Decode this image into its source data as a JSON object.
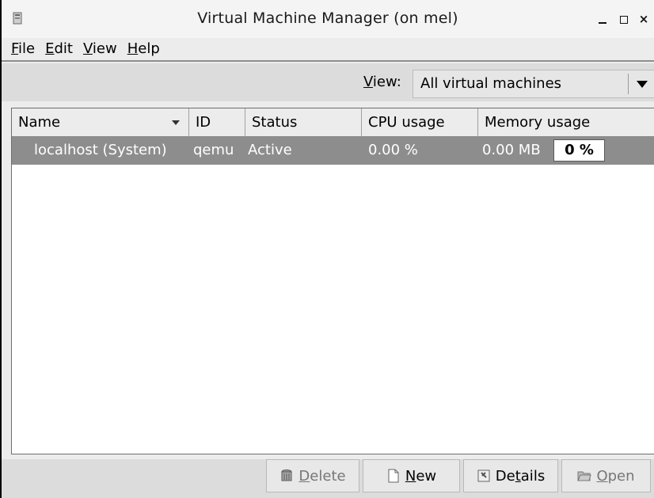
{
  "window": {
    "title": "Virtual Machine Manager (on mel)",
    "minimize_glyph": "",
    "maximize_glyph": "",
    "close_glyph": "×"
  },
  "menubar": {
    "items": [
      {
        "access_key": "F",
        "rest": "ile"
      },
      {
        "access_key": "E",
        "rest": "dit"
      },
      {
        "access_key": "V",
        "rest": "iew"
      },
      {
        "access_key": "H",
        "rest": "elp"
      }
    ]
  },
  "filter": {
    "label_key": "V",
    "label_rest": "iew:",
    "selected": "All virtual machines"
  },
  "columns": {
    "name": "Name",
    "id": "ID",
    "status": "Status",
    "cpu": "CPU usage",
    "memory": "Memory usage"
  },
  "rows": [
    {
      "name": "localhost (System)",
      "id": "qemu",
      "status": "Active",
      "cpu": "0.00 %",
      "memory": "0.00 MB",
      "memory_percent": "0 %"
    }
  ],
  "buttons": {
    "delete": {
      "key": "D",
      "rest": "elete",
      "enabled": false
    },
    "new": {
      "key": "N",
      "rest": "ew",
      "enabled": true
    },
    "details": {
      "pre": "De",
      "key": "t",
      "rest": "ails",
      "enabled": true
    },
    "open": {
      "key": "O",
      "rest": "pen",
      "enabled": false
    }
  },
  "colors": {
    "selected_row": "#8d8d8d",
    "window_bg": "#ececec"
  }
}
